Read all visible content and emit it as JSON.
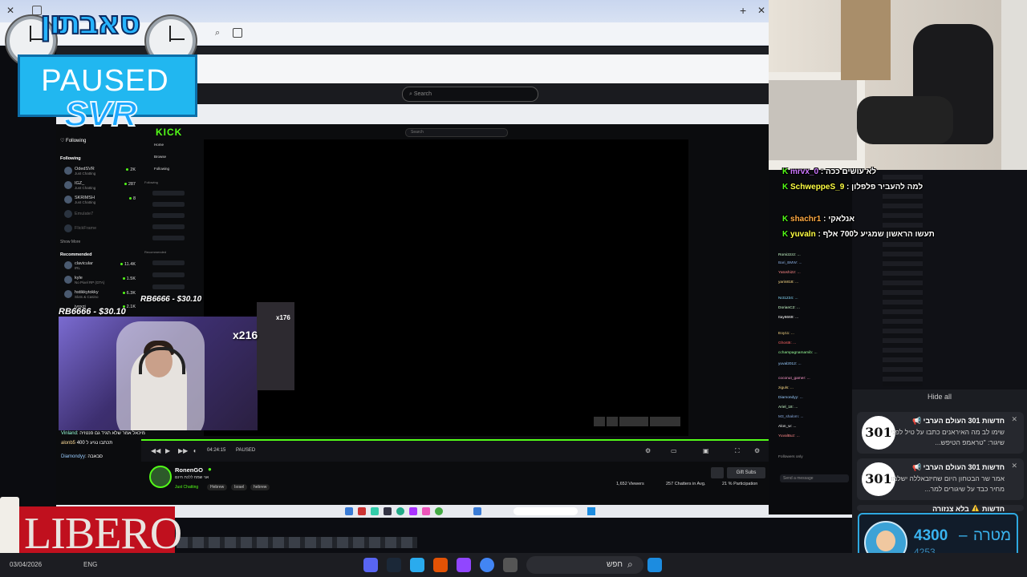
{
  "overlay": {
    "logo_text": "סאבתון",
    "paused_label": "PAUSED",
    "svr_label": "SVR",
    "donation_1": "RB6666 - $30.10",
    "donation_2": "RB6666 - $30.10",
    "multiplier_1": "x216",
    "multiplier_2": "x176",
    "sponsor": "LIBERO"
  },
  "browser": {
    "new_tab": "+",
    "close": "✕",
    "inner_search_placeholder": "Search",
    "kick_search_placeholder": "Search"
  },
  "kick": {
    "brand": "KICK",
    "following_header": "Following",
    "following_label": "Following",
    "menu": [
      "Home",
      "Browse",
      "Following"
    ],
    "menu_following": "Following",
    "menu_recommended": "Recommended",
    "following_channels": [
      {
        "name": "OdedSVR",
        "sub": "Just Chatting",
        "count": "2K"
      },
      {
        "name": "IGZ_",
        "sub": "Just Chatting",
        "count": "287"
      },
      {
        "name": "SKRIMSH",
        "sub": "Just Chatting",
        "count": "8"
      },
      {
        "name": "Emulate7",
        "sub": "",
        "count": ""
      },
      {
        "name": "FlickFrame",
        "sub": "",
        "count": ""
      }
    ],
    "show_more": "Show More",
    "recommended_header": "Recommended",
    "recommended_channels": [
      {
        "name": "clavicular",
        "sub": "IRL",
        "count": "11.4K"
      },
      {
        "name": "kyle",
        "sub": "No Pixel RP (GTA)",
        "count": "1.5K"
      },
      {
        "name": "hstikkytokky",
        "sub": "Slots & Casino",
        "count": "6.3K"
      },
      {
        "name": "jynxzi",
        "sub": "",
        "count": "2.1K"
      }
    ],
    "player_time": "04:24:15",
    "player_state": "PAUSED",
    "streamer_name": "RonenGO",
    "stream_title": "אני שמח ללכת חינם",
    "category": "Just Chatting",
    "tags": [
      "Hebrew",
      "Israel",
      "hebrew"
    ],
    "viewers": "1,652 Viewers",
    "chatters": "257 Chatters in Avg.",
    "participation": "21 % Participation",
    "gift_subs": "Gift Subs",
    "followers_only": "Followers only",
    "send_message": "Send a message"
  },
  "stream_chat_left": [
    {
      "user": "Vinland",
      "msg": "מיכאל אמר שלא תגיד גם פנטזיה"
    },
    {
      "user": "alonb5",
      "msg": "תכתבו נגיע ל 400"
    },
    {
      "user": "Diamondyy",
      "msg": "סבאבה"
    }
  ],
  "chat_overlay": [
    {
      "user": "mrvx_0",
      "msg": "לא עושים ככה"
    },
    {
      "user": "SchweppeS_9",
      "msg": "למה להעביר פלפלון"
    },
    {
      "user": "shachr1",
      "msg": "אנלאקי"
    },
    {
      "user": "yuvaln",
      "msg": "תעשו הראשון שמגיע ל700 אלף"
    }
  ],
  "chat_users": [
    "Romi2zzz",
    "Bari_BMW",
    "Yatoshi22",
    "yarin818",
    "Nct1234",
    "DorianC2",
    "Itay6669",
    "Eoy11",
    "Ghost6",
    "cchampagnamamib",
    "yuval2012",
    "coconut_gamer",
    "ziguls",
    "Diamondyy",
    "Ariel_18",
    "M3_shalom",
    "Alon_w",
    "YuvalBuz"
  ],
  "notifications": {
    "hide_all": "Hide all",
    "items": [
      {
        "logo": "301",
        "title": "חדשות 301 העולם הערבי 📢",
        "body": "שימו לב מה האיראנים כתבו על טיל לפני שיגור: \"טראמפ הטיפש..."
      },
      {
        "logo": "301",
        "title": "חדשות 301 העולם הערבי 📢",
        "body": "אמר שר הבטחון היום שחיזבאללה ישלמו מחיר כבד על שיגורים למר..."
      },
      {
        "logo": "301",
        "title": "חדשות ⚠️ בלא צנזורה",
        "body": ""
      }
    ]
  },
  "goal": {
    "current": "4300",
    "label": "מטרה",
    "separator": "–",
    "next": "4253"
  },
  "taskbar": {
    "search_label": "חפש",
    "date": "03/04/2026",
    "lang": "ENG"
  },
  "colors": {
    "kick_green": "#53fc18",
    "paused_blue": "#21b7f0",
    "libero_red": "#c0101e",
    "goal_border": "#2ea8e0"
  }
}
